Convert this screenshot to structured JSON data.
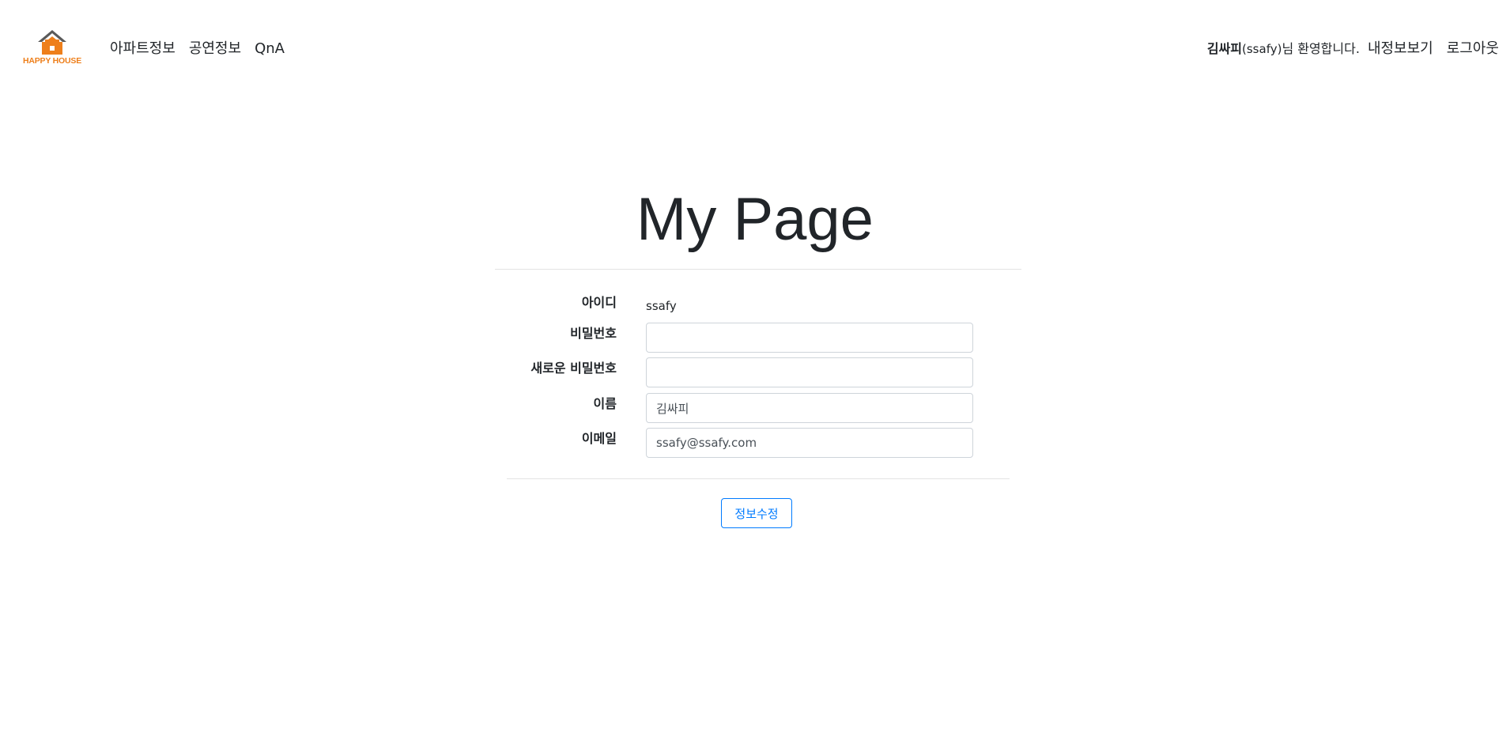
{
  "brand": {
    "logo_text": "HAPPY HOUSE",
    "logo_icon": "house-icon",
    "colors": {
      "roof": "#5a5a5a",
      "house": "#ee7f1b"
    }
  },
  "nav": {
    "left_links": [
      "아파트정보",
      "공연정보",
      "QnA"
    ],
    "welcome": {
      "name": "김싸피",
      "id": "(ssafy)",
      "suffix": "님 환영합니다."
    },
    "right_links": [
      "내정보보기",
      "로그아웃"
    ]
  },
  "page": {
    "title": "My Page"
  },
  "form": {
    "id": {
      "label": "아이디",
      "value": "ssafy"
    },
    "password": {
      "label": "비밀번호",
      "value": ""
    },
    "new_password": {
      "label": "새로운 비밀번호",
      "value": ""
    },
    "name": {
      "label": "이름",
      "value": "김싸피"
    },
    "email": {
      "label": "이메일",
      "value": "ssafy@ssafy.com"
    },
    "submit_label": "정보수정"
  },
  "colors": {
    "accent": "#007bff",
    "border": "#ced4da",
    "divider": "#e3e3e3"
  }
}
